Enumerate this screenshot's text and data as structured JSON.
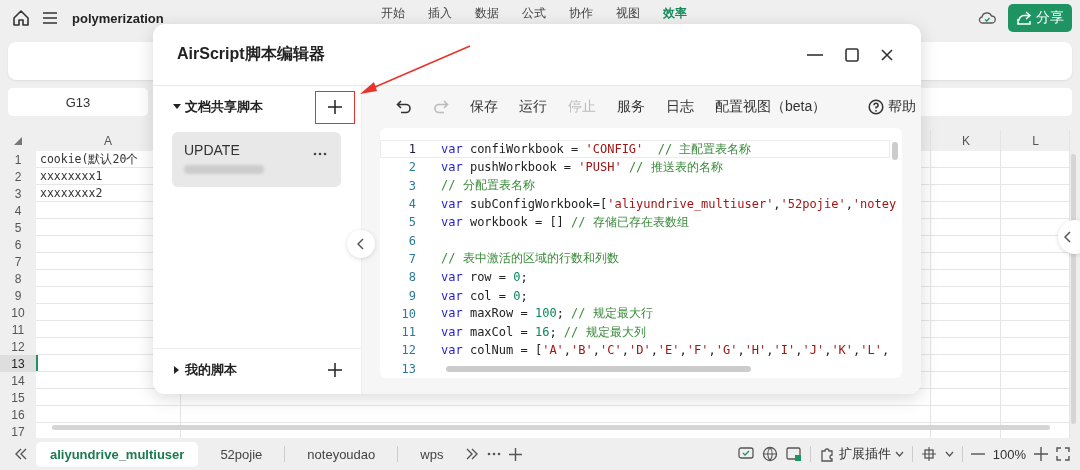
{
  "app": {
    "doc_title": "polymerization",
    "menu_tabs": [
      {
        "label": "开始",
        "selected": false
      },
      {
        "label": "插入",
        "selected": false
      },
      {
        "label": "数据",
        "selected": false
      },
      {
        "label": "公式",
        "selected": false
      },
      {
        "label": "协作",
        "selected": false
      },
      {
        "label": "视图",
        "selected": false
      },
      {
        "label": "效率",
        "selected": true
      }
    ],
    "share_button": "分享"
  },
  "name_box": "G13",
  "grid": {
    "columns": [
      {
        "label": "A"
      },
      {
        "label": "K"
      },
      {
        "label": "L"
      }
    ],
    "rows": [
      {
        "number": "1",
        "selected": false,
        "cell": "cookie(默认20个"
      },
      {
        "number": "2",
        "selected": false,
        "cell": "xxxxxxxx1"
      },
      {
        "number": "3",
        "selected": false,
        "cell": "xxxxxxxx2"
      },
      {
        "number": "4",
        "selected": false
      },
      {
        "number": "5",
        "selected": false
      },
      {
        "number": "6",
        "selected": false
      },
      {
        "number": "7",
        "selected": false
      },
      {
        "number": "8",
        "selected": false
      },
      {
        "number": "9",
        "selected": false
      },
      {
        "number": "10",
        "selected": false
      },
      {
        "number": "11",
        "selected": false
      },
      {
        "number": "12",
        "selected": false
      },
      {
        "number": "13",
        "selected": true
      },
      {
        "number": "14",
        "selected": false
      },
      {
        "number": "15",
        "selected": false
      },
      {
        "number": "16",
        "selected": false
      },
      {
        "number": "17",
        "selected": false
      }
    ]
  },
  "sheet_tabs": [
    {
      "label": "aliyundrive_multiuser",
      "selected": true
    },
    {
      "label": "52pojie",
      "selected": false
    },
    {
      "label": "noteyoudao",
      "selected": false
    },
    {
      "label": "wps",
      "selected": false
    }
  ],
  "status_bar": {
    "extensions": "扩展插件",
    "zoom": "100%"
  },
  "dialog": {
    "title": "AirScript脚本编辑器",
    "shared_section": {
      "label": "文档共享脚本",
      "expanded": true
    },
    "scripts": [
      {
        "name": "UPDATE",
        "selected": true
      }
    ],
    "my_section": {
      "label": "我的脚本",
      "expanded": false
    },
    "toolbar": [
      {
        "kind": "undo",
        "disabled": false
      },
      {
        "kind": "redo",
        "disabled": true
      },
      {
        "kind": "text",
        "label": "保存",
        "disabled": false
      },
      {
        "kind": "text",
        "label": "运行",
        "disabled": false
      },
      {
        "kind": "text",
        "label": "停止",
        "disabled": true
      },
      {
        "kind": "text",
        "label": "服务",
        "disabled": false
      },
      {
        "kind": "text",
        "label": "日志",
        "disabled": false
      },
      {
        "kind": "text",
        "label": "配置视图（beta）",
        "disabled": false
      },
      {
        "kind": "help",
        "label": "帮助",
        "disabled": false
      }
    ],
    "code": [
      {
        "number": "1",
        "current": true,
        "text": "var confiWorkbook = 'CONFIG'  // 主配置表名称"
      },
      {
        "number": "2",
        "current": false,
        "text": "var pushWorkbook = 'PUSH' // 推送表的名称"
      },
      {
        "number": "3",
        "current": false,
        "text": "// 分配置表名称"
      },
      {
        "number": "4",
        "current": false,
        "text": "var subConfigWorkbook=['aliyundrive_multiuser','52pojie','notey"
      },
      {
        "number": "5",
        "current": false,
        "text": "var workbook = [] // 存储已存在表数组"
      },
      {
        "number": "6",
        "current": false
      },
      {
        "number": "7",
        "current": false,
        "text": "// 表中激活的区域的行数和列数"
      },
      {
        "number": "8",
        "current": false,
        "text": "var row = 0;"
      },
      {
        "number": "9",
        "current": false,
        "text": "var col = 0;"
      },
      {
        "number": "10",
        "current": false,
        "text": "var maxRow = 100; // 规定最大行"
      },
      {
        "number": "11",
        "current": false,
        "text": "var maxCol = 16; // 规定最大列"
      },
      {
        "number": "12",
        "current": false,
        "text": "var colNum = ['A','B','C','D','E','F','G','H','I','J','K','L',"
      },
      {
        "number": "13",
        "current": false
      }
    ]
  }
}
